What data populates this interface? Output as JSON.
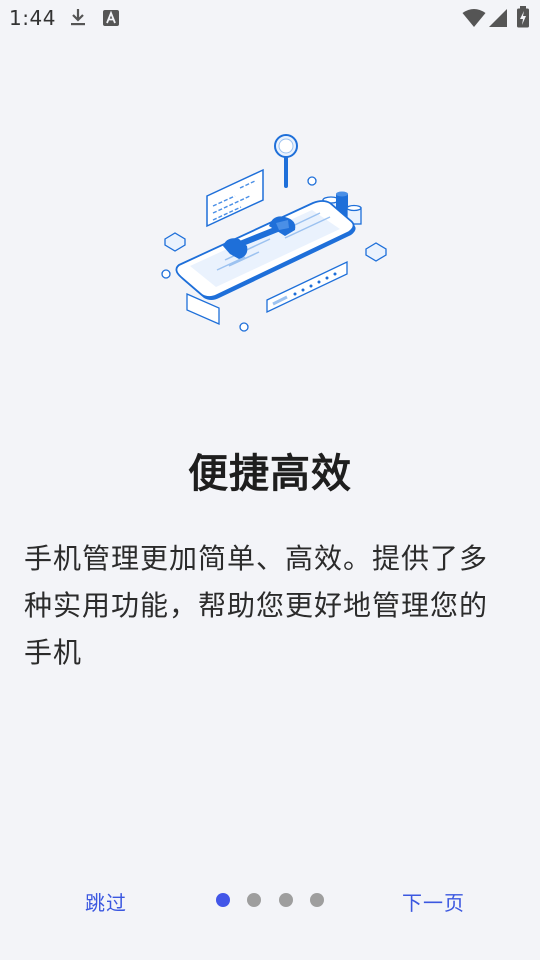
{
  "status_bar": {
    "time": "1:44",
    "icons": [
      "download-icon",
      "a-keyboard-icon",
      "wifi-icon",
      "signal-icon",
      "battery-charging-icon"
    ]
  },
  "illustration": {
    "icon": "phone-tools-illustration",
    "accent": "#1e6fd9"
  },
  "onboarding": {
    "title": "便捷高效",
    "description": "手机管理更加简单、高效。提供了多种实用功能，帮助您更好地管理您的手机"
  },
  "footer": {
    "skip_label": "跳过",
    "next_label": "下一页",
    "page_count": 4,
    "current_page": 1
  },
  "colors": {
    "background": "#f3f4f8",
    "accent": "#3b57e0",
    "dot_active": "#4256e8",
    "dot_inactive": "#9e9e9e"
  }
}
